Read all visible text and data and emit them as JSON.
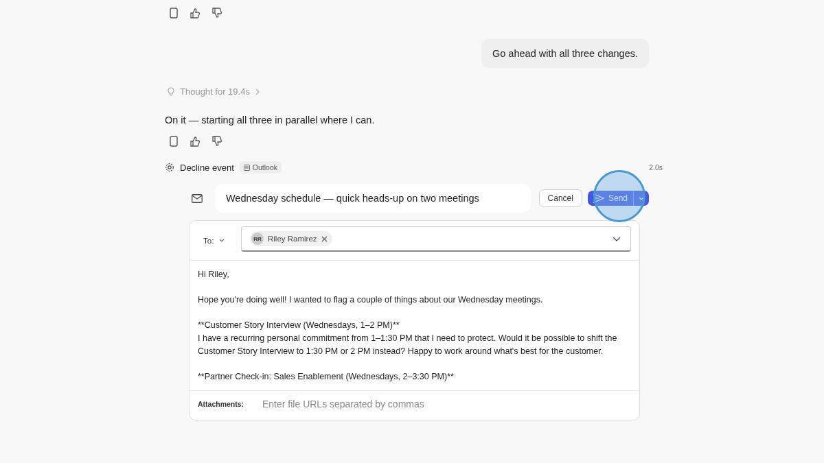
{
  "user_message": "Go ahead with all three changes.",
  "thought": {
    "label": "Thought for 19.4s"
  },
  "reply": "On it — starting all three in parallel where I can.",
  "action": {
    "label": "Decline event",
    "app": "Outlook",
    "duration": "2.0s"
  },
  "email": {
    "subject": "Wednesday schedule — quick heads-up on two meetings",
    "cancel": "Cancel",
    "send": "Send",
    "highlighted": true,
    "to_label": "To:",
    "recipients": [
      {
        "initials": "RR",
        "name": "Riley Ramirez"
      }
    ],
    "body": [
      [
        "Hi Riley,"
      ],
      [
        "Hope you're doing well! I wanted to flag a couple of things about our Wednesday meetings."
      ],
      [
        "**Customer Story Interview (Wednesdays, 1–2 PM)**",
        "I have a recurring personal commitment from 1–1:30 PM that I need to protect. Would it be possible to shift the Customer Story Interview to 1:30 PM or 2 PM instead? Happy to work around what's best for the customer."
      ],
      [
        "**Partner Check-in: Sales Enablement (Wednesdays, 2–3:30 PM)**"
      ]
    ],
    "attachments_label": "Attachments:",
    "attachments_placeholder": "Enter file URLs separated by commas"
  }
}
